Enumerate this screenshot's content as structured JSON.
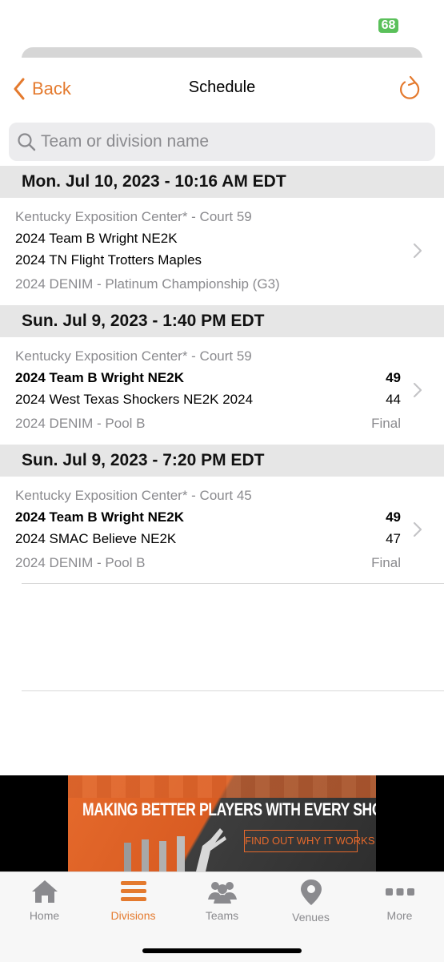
{
  "status_bar": {
    "battery": "68"
  },
  "nav": {
    "back_label": "Back",
    "title": "Schedule"
  },
  "search": {
    "placeholder": "Team or division name",
    "value": ""
  },
  "schedule": [
    {
      "date_header": "Mon. Jul 10, 2023 - 10:16 AM EDT",
      "venue": "Kentucky Exposition Center* - Court 59",
      "team1": "2024 Team B Wright NE2K",
      "team2": "2024 TN Flight Trotters Maples",
      "score1": "",
      "score2": "",
      "division": "2024 DENIM - Platinum Championship (G3)",
      "status": ""
    },
    {
      "date_header": "Sun. Jul 9, 2023 - 1:40 PM EDT",
      "venue": "Kentucky Exposition Center* - Court 59",
      "team1": "2024 Team B Wright NE2K",
      "team2": "2024 West Texas Shockers NE2K 2024",
      "score1": "49",
      "score2": "44",
      "division": "2024 DENIM - Pool B",
      "status": "Final"
    },
    {
      "date_header": "Sun. Jul 9, 2023 - 7:20 PM EDT",
      "venue": "Kentucky Exposition Center* - Court 45",
      "team1": "2024 Team B Wright NE2K",
      "team2": "2024 SMAC Believe NE2K",
      "score1": "49",
      "score2": "47",
      "division": "2024 DENIM - Pool B",
      "status": "Final"
    }
  ],
  "ad": {
    "headline": "MAKING BETTER PLAYERS WITH EVERY SHOT",
    "cta": "FIND OUT WHY IT WORKS"
  },
  "tabs": [
    {
      "label": "Home",
      "icon": "home-icon",
      "active": false
    },
    {
      "label": "Divisions",
      "icon": "divisions-icon",
      "active": true
    },
    {
      "label": "Teams",
      "icon": "teams-icon",
      "active": false
    },
    {
      "label": "Venues",
      "icon": "location-pin-icon",
      "active": false
    },
    {
      "label": "More",
      "icon": "more-icon",
      "active": false
    }
  ],
  "colors": {
    "accent": "#e47a2e",
    "inactive": "#8a8a8e",
    "header_bg": "#e6e6e6"
  }
}
